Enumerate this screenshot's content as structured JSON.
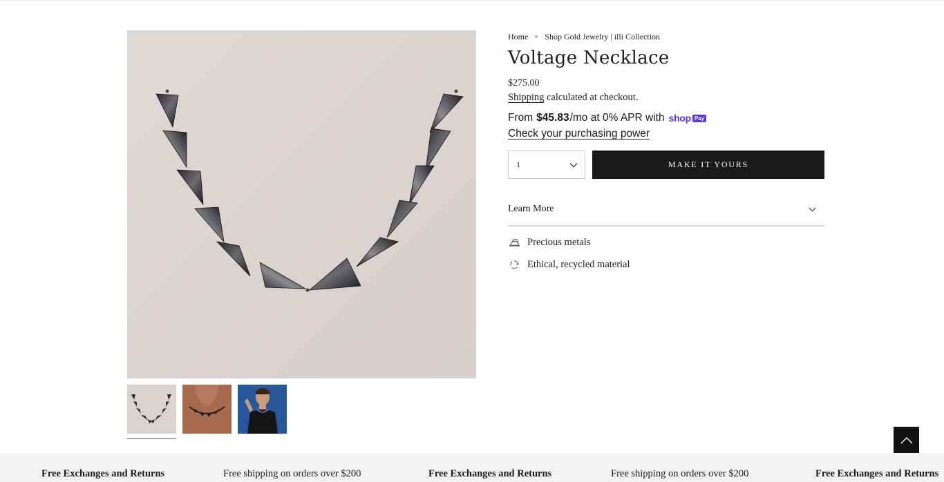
{
  "breadcrumb": {
    "home": "Home",
    "current": "Shop Gold Jewelry | illi Collection"
  },
  "product": {
    "title": "Voltage Necklace",
    "price": "$275.00",
    "shipping_link": "Shipping",
    "shipping_text": " calculated at checkout.",
    "installments": {
      "prefix": "From",
      "amount": "$45.83",
      "suffix": "/mo at 0% APR with",
      "brand": "shop",
      "brand_badge": "Pay",
      "link": "Check your purchasing power"
    },
    "quantity": "1",
    "cta": "MAKE IT YOURS",
    "accordion_label": "Learn More",
    "features": [
      {
        "label": "Precious metals",
        "icon": "precious-metals-icon"
      },
      {
        "label": "Ethical, recycled material",
        "icon": "recycle-icon"
      }
    ],
    "thumbnails": [
      {
        "alt": "necklace-flatlay",
        "icon": "thumbnail-necklace"
      },
      {
        "alt": "necklace-on-neck",
        "icon": "thumbnail-neck"
      },
      {
        "alt": "model-wearing-necklace",
        "icon": "thumbnail-model"
      }
    ],
    "selected_thumbnail": 0
  },
  "footer_marquee": {
    "items": [
      "Free Exchanges and Returns",
      "Free shipping on orders over $200",
      "Free Exchanges and Returns",
      "Free shipping on orders over $200",
      "Free Exchanges and Returns"
    ]
  },
  "colors": {
    "accent": "#1a1a1a",
    "shop_pay": "#5a31f4",
    "image_background": "#dcd6d3",
    "footer_background": "#f2f2f2"
  }
}
